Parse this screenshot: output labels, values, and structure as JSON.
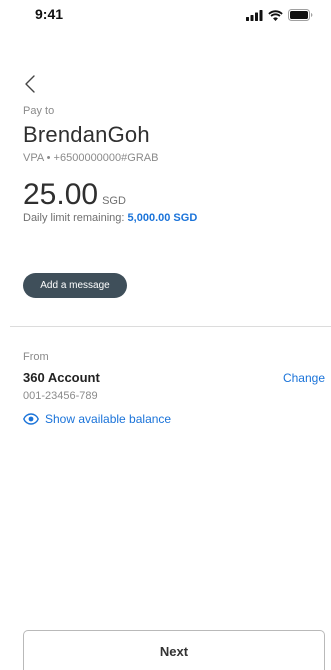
{
  "status_bar": {
    "time": "9:41",
    "icons": [
      "signal-icon",
      "wifi-icon",
      "battery-icon"
    ]
  },
  "nav": {
    "back_icon": "chevron-left-icon"
  },
  "payee": {
    "pay_to_label": "Pay to",
    "name": "BrendanGoh",
    "vpa": "VPA • +6500000000#GRAB"
  },
  "amount": {
    "value": "25.00",
    "currency": "SGD"
  },
  "limit": {
    "label": "Daily limit remaining:",
    "value": "5,000.00 SGD"
  },
  "message": {
    "button_label": "Add a message"
  },
  "source": {
    "from_label": "From",
    "account_name": "360 Account",
    "change_label": "Change",
    "account_number": "001-23456-789",
    "show_balance_label": "Show available balance",
    "show_balance_icon": "eye-icon"
  },
  "footer": {
    "next_label": "Next"
  },
  "colors": {
    "accent": "#1a73d9",
    "button_dark": "#3f4f5a",
    "text_primary": "#2f2f2f",
    "text_secondary": "#8a8a8a",
    "divider": "#dcdcdc"
  }
}
